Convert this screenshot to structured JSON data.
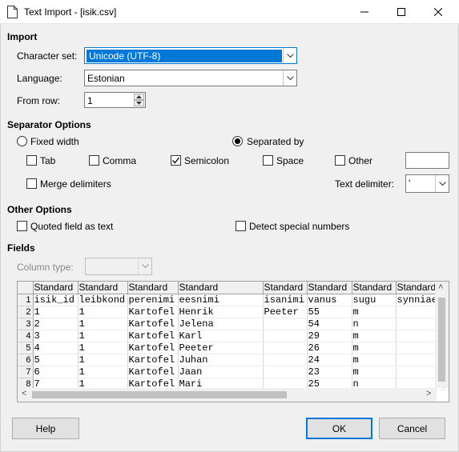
{
  "window": {
    "title": "Text Import - [isik.csv]",
    "icon": "document-icon"
  },
  "import": {
    "heading": "Import",
    "charset_label": "Character set:",
    "charset_value": "Unicode (UTF-8)",
    "language_label": "Language:",
    "language_value": "Estonian",
    "from_row_label": "From row:",
    "from_row_value": "1"
  },
  "separator": {
    "heading": "Separator Options",
    "fixed_width": "Fixed width",
    "separated_by": "Separated by",
    "selected_mode": "separated_by",
    "tab": "Tab",
    "comma": "Comma",
    "semicolon": "Semicolon",
    "space": "Space",
    "other": "Other",
    "other_value": "",
    "merge": "Merge delimiters",
    "text_delim_label": "Text delimiter:",
    "text_delim_value": "'",
    "checked": {
      "tab": false,
      "comma": false,
      "semicolon": true,
      "space": false,
      "other": false,
      "merge": false
    }
  },
  "other_options": {
    "heading": "Other Options",
    "quoted": "Quoted field as text",
    "detect": "Detect special numbers",
    "checked": {
      "quoted": false,
      "detect": false
    }
  },
  "fields": {
    "heading": "Fields",
    "column_type_label": "Column type:",
    "column_type_value": "",
    "columns": [
      "Standard",
      "Standard",
      "Standard",
      "Standard",
      "Standard",
      "Standard",
      "Standard",
      "Standard"
    ],
    "row_numbers": [
      "1",
      "2",
      "3",
      "4",
      "5",
      "6",
      "7",
      "8"
    ],
    "rows": [
      [
        "isik_id",
        "leibkond",
        "perenimi",
        "eesnimi",
        "isanimi",
        "vanus",
        "sugu",
        "synniae"
      ],
      [
        "1",
        "1",
        "Kartofel",
        "Henrik",
        "Peeter",
        "55",
        "m",
        ""
      ],
      [
        "2",
        "1",
        "Kartofel",
        "Jelena",
        "",
        "54",
        "n",
        ""
      ],
      [
        "3",
        "1",
        "Kartofel",
        "Karl",
        "",
        "29",
        "m",
        ""
      ],
      [
        "4",
        "1",
        "Kartofel",
        "Peeter",
        "",
        "26",
        "m",
        ""
      ],
      [
        "5",
        "1",
        "Kartofel",
        "Juhan",
        "",
        "24",
        "m",
        ""
      ],
      [
        "6",
        "1",
        "Kartofel",
        "Jaan",
        "",
        "23",
        "m",
        ""
      ],
      [
        "7",
        "1",
        "Kartofel",
        "Mari",
        "",
        "25",
        "n",
        ""
      ]
    ]
  },
  "buttons": {
    "help": "Help",
    "ok": "OK",
    "cancel": "Cancel"
  },
  "colors": {
    "accent": "#0078d7",
    "background": "#f0f0f0"
  }
}
